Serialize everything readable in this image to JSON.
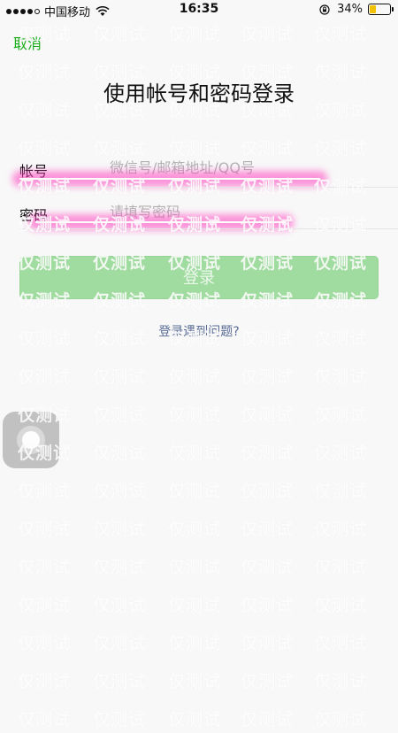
{
  "status_bar": {
    "carrier": "中国移动",
    "time": "16:35",
    "battery_percent": "34%",
    "battery_level": 0.34,
    "battery_color": "#f2c200",
    "icons": [
      "signal-dots-icon",
      "wifi-icon",
      "orientation-lock-icon",
      "battery-icon"
    ]
  },
  "nav": {
    "cancel_label": "取消"
  },
  "title": "使用帐号和密码登录",
  "form": {
    "account": {
      "label": "帐号",
      "placeholder": "微信号/邮箱地址/QQ号"
    },
    "password": {
      "label": "密码",
      "placeholder": "请填写密码"
    }
  },
  "login_button": {
    "label": "登录"
  },
  "help_link": "登录遇到问题?",
  "watermark_text": "仅测试",
  "colors": {
    "accent_green": "#1aad19",
    "button_disabled": "#a0dca0",
    "link_blue": "#576b95",
    "redaction_pink": "#ff3fc0"
  }
}
